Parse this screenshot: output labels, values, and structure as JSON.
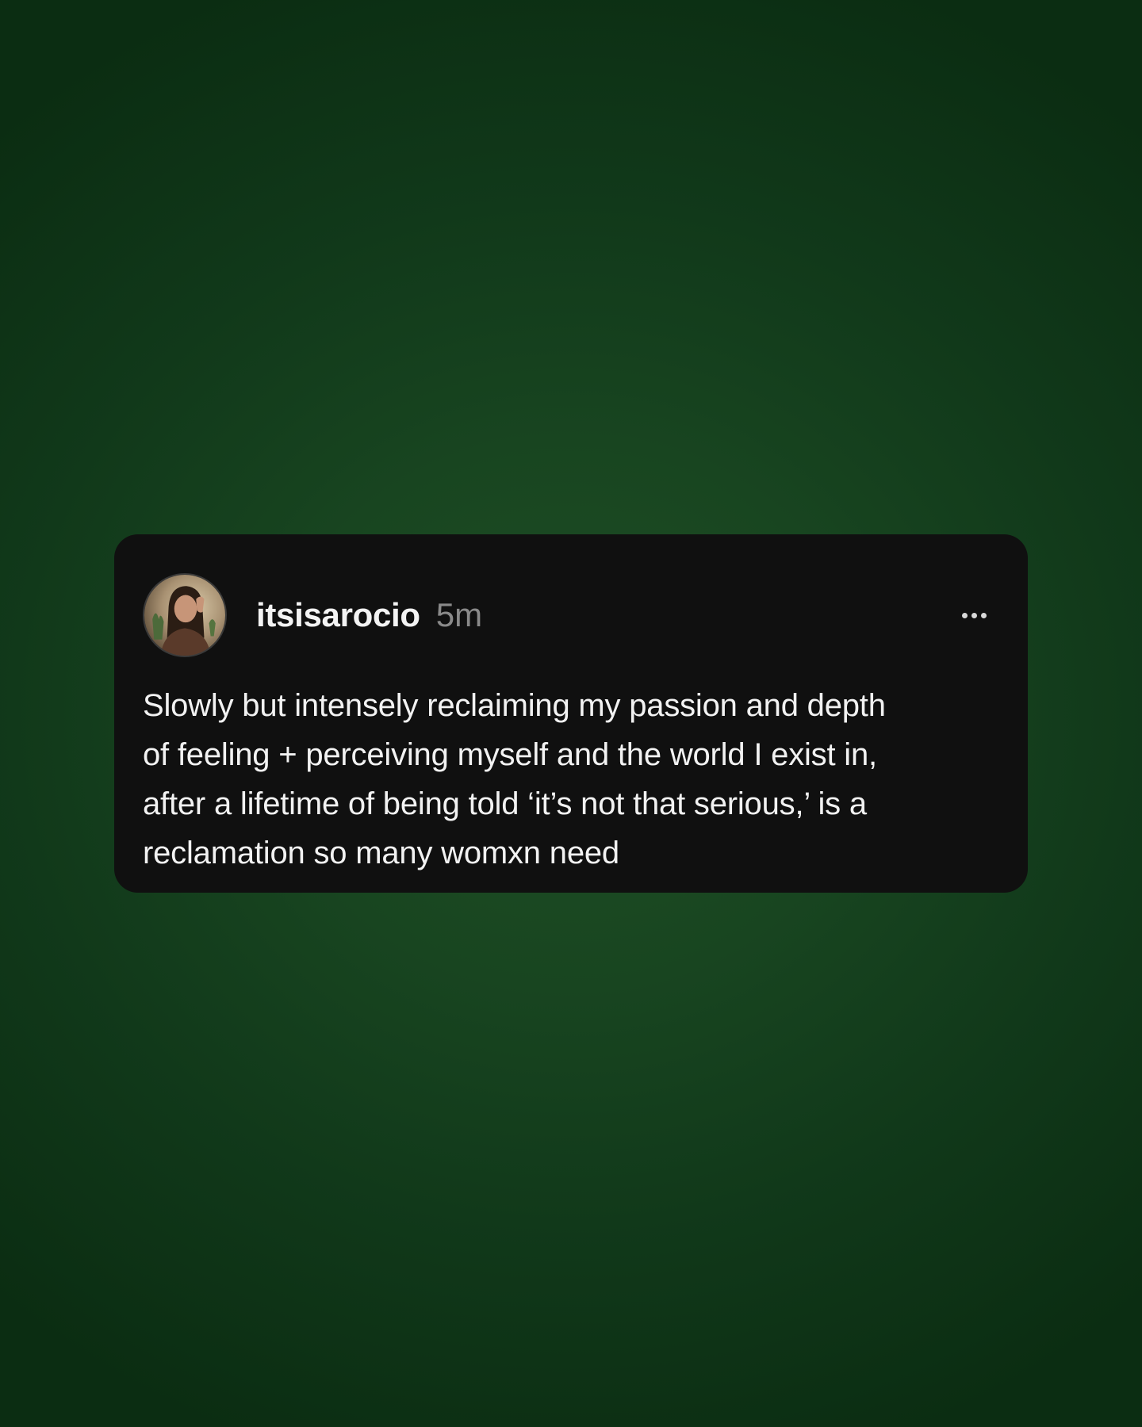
{
  "post": {
    "username": "itsisarocio",
    "timestamp": "5m",
    "avatar_icon": "profile-photo",
    "more_icon": "more-horizontal-icon",
    "text_lines": [
      "Slowly but intensely reclaiming my passion and depth",
      "of feeling + perceiving myself and the world I exist in,",
      "after a lifetime of being told ‘it’s not that serious,’ is a",
      "reclamation so many womxn need"
    ]
  },
  "colors": {
    "background": "#184520",
    "card": "#101010",
    "text_primary": "#f2f2f2",
    "text_secondary": "#8a8a8a"
  }
}
